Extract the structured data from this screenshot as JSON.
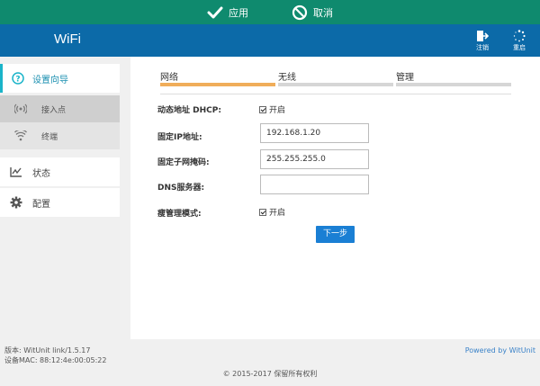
{
  "action_bar": {
    "apply_label": "应用",
    "cancel_label": "取消"
  },
  "header": {
    "title": "WiFi",
    "logout_label": "注销",
    "restart_label": "重启"
  },
  "sidebar": {
    "setup_wizard": "设置向导",
    "sub_items": [
      {
        "label": "接入点",
        "icon": "wifi-signal-icon"
      },
      {
        "label": "终端",
        "icon": "wifi-icon"
      }
    ],
    "status": "状态",
    "config": "配置"
  },
  "tabs": [
    {
      "label": "网络",
      "active": true
    },
    {
      "label": "无线",
      "active": false
    },
    {
      "label": "管理",
      "active": false
    }
  ],
  "form": {
    "dhcp_label": "动态地址 DHCP:",
    "dhcp_check": "开启",
    "ip_label": "固定IP地址:",
    "ip_value": "192.168.1.20",
    "mask_label": "固定子网掩码:",
    "mask_value": "255.255.255.0",
    "dns_label": "DNS服务器:",
    "dns_value": "",
    "thin_label": "瘦管理模式:",
    "thin_check": "开启",
    "next_label": "下一步"
  },
  "footer": {
    "version": "版本: WitUnit link/1.5.17",
    "mac": "设备MAC: 88:12:4e:00:05:22",
    "powered": "Powered by WitUnit",
    "copyright": "© 2015-2017 保留所有权利"
  },
  "colors": {
    "action_bar": "#0f8a6e",
    "header": "#0c6aa8",
    "active_tab": "#f0ad5a",
    "accent": "#1ab4c9",
    "button": "#1a7fd4"
  }
}
